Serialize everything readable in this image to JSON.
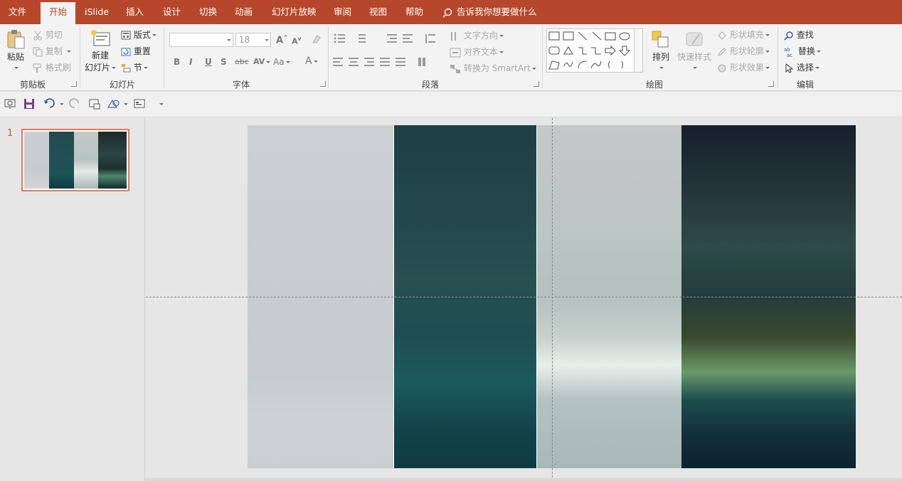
{
  "menu": {
    "tabs": [
      "文件",
      "开始",
      "iSlide",
      "插入",
      "设计",
      "切换",
      "动画",
      "幻灯片放映",
      "审阅",
      "视图",
      "帮助"
    ],
    "active_tab": "开始",
    "tell_me": "告诉我你想要做什么"
  },
  "ribbon": {
    "clipboard": {
      "paste": "粘贴",
      "cut": "剪切",
      "copy": "复制",
      "format_painter": "格式刷",
      "label": "剪贴板"
    },
    "slides": {
      "new_slide_line1": "新建",
      "new_slide_line2": "幻灯片",
      "layout": "版式",
      "reset": "重置",
      "section": "节",
      "label": "幻灯片"
    },
    "font": {
      "font_name": "",
      "font_size": "18",
      "grow": "A",
      "shrink": "A",
      "bold": "B",
      "italic": "I",
      "underline": "U",
      "shadow": "S",
      "strike": "abc",
      "spacing": "AV",
      "case": "Aa",
      "color": "A",
      "label": "字体"
    },
    "paragraph": {
      "text_direction": "文字方向",
      "align_text": "对齐文本",
      "smartart": "转换为 SmartArt",
      "label": "段落"
    },
    "drawing": {
      "arrange": "排列",
      "quick_styles": "快速样式",
      "shape_fill": "形状填充",
      "shape_outline": "形状轮廓",
      "shape_effects": "形状效果",
      "label": "绘图"
    },
    "editing": {
      "find": "查找",
      "replace": "替换",
      "select": "选择",
      "label": "编辑"
    }
  },
  "thumbnails": [
    {
      "number": "1"
    }
  ],
  "colors": {
    "accent": "#b7472a",
    "selection": "#e07a5a",
    "teal_dark": "#0f3c43"
  }
}
